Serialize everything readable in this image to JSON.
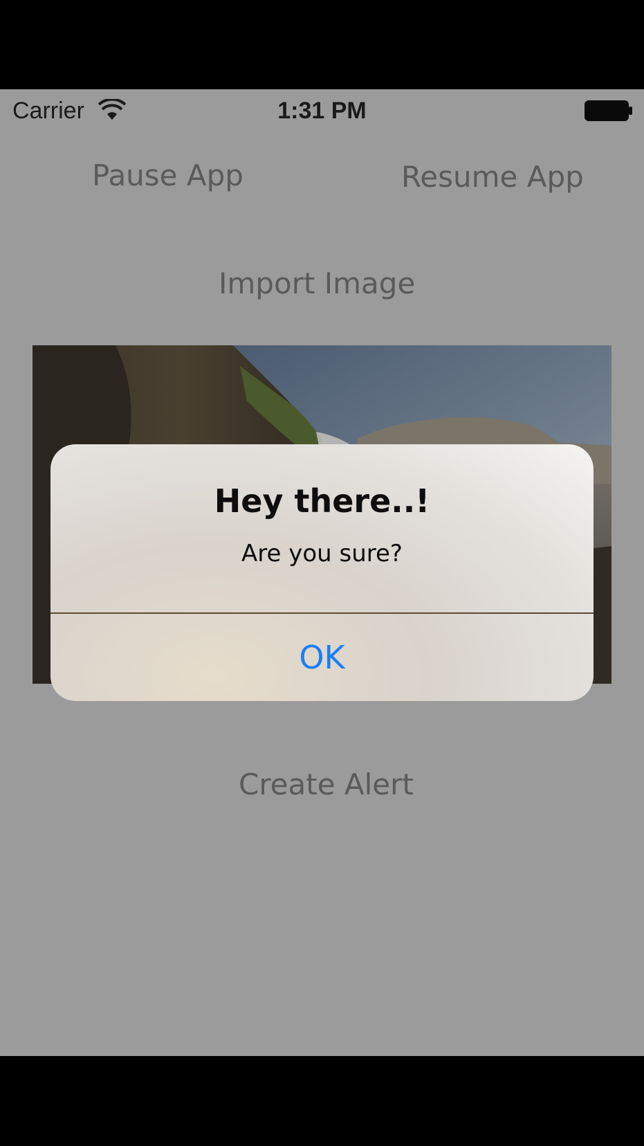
{
  "status_bar": {
    "carrier": "Carrier",
    "time": "1:31 PM",
    "wifi_icon": "wifi-icon",
    "battery_icon": "battery-icon"
  },
  "buttons": {
    "pause": "Pause App",
    "resume": "Resume App",
    "import_image": "Import Image",
    "create_alert": "Create Alert"
  },
  "alert": {
    "title": "Hey there..!",
    "message": "Are you sure?",
    "ok": "OK"
  },
  "colors": {
    "screen_background": "#9b9b9b",
    "button_text": "#5a5a5a",
    "alert_action": "#1a7ef5"
  }
}
